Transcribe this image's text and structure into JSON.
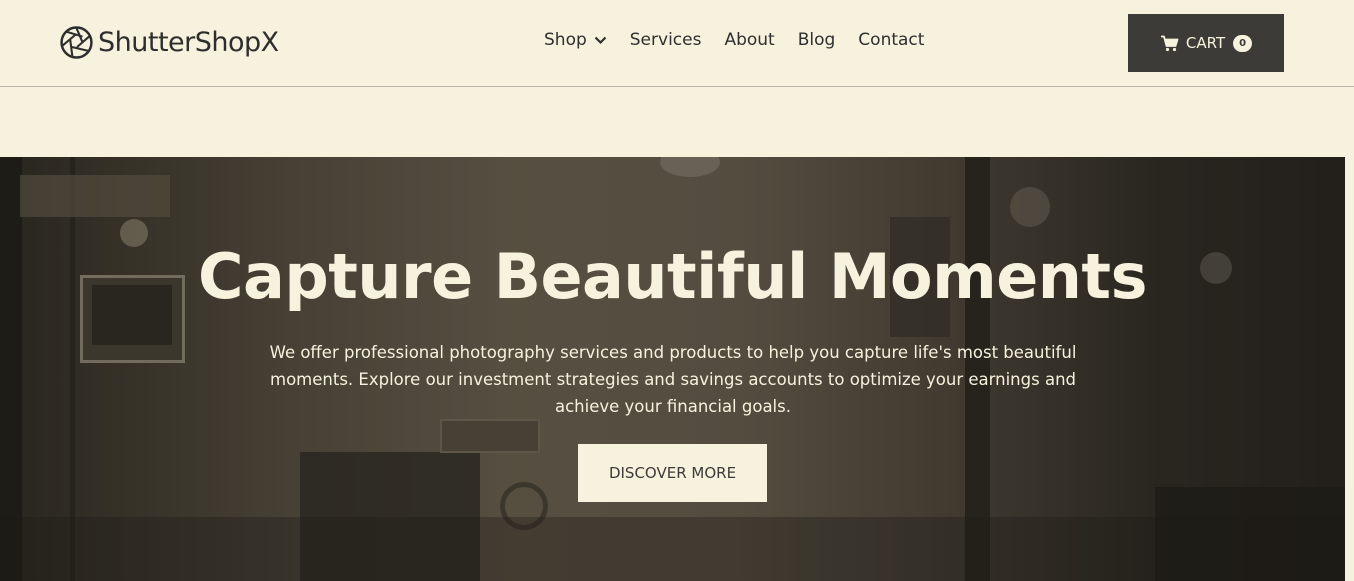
{
  "brand": {
    "name": "ShutterShopX",
    "logo_icon": "camera-aperture-icon"
  },
  "nav": {
    "items": [
      {
        "label": "Shop",
        "has_dropdown": true
      },
      {
        "label": "Services"
      },
      {
        "label": "About"
      },
      {
        "label": "Blog"
      },
      {
        "label": "Contact"
      }
    ]
  },
  "cart": {
    "label": "CART",
    "count": "0",
    "icon": "shopping-cart-icon"
  },
  "hero": {
    "title": "Capture Beautiful Moments",
    "text": "We offer professional photography services and products to help you capture life's most beautiful moments. Explore our investment strategies and savings accounts to optimize your earnings and achieve your financial goals.",
    "button_label": "DISCOVER MORE"
  },
  "colors": {
    "cream": "#f6f2dd",
    "dark": "#3d3b38"
  }
}
